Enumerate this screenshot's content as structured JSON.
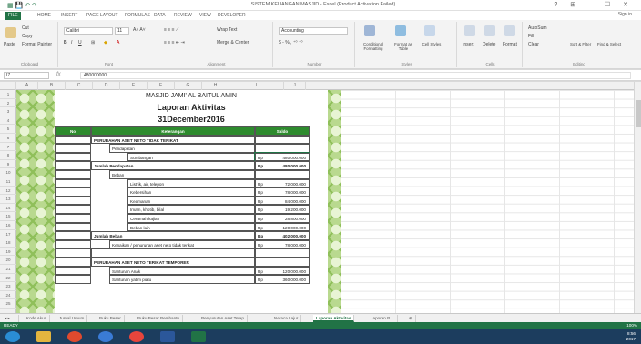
{
  "window": {
    "title": "SISTEM KEUANGAN MASJID - Excel (Product Activation Failed)",
    "controls": "? ⊞ – ☐ ✕"
  },
  "ribbon_tabs": [
    "FILE",
    "HOME",
    "INSERT",
    "PAGE LAYOUT",
    "FORMULAS",
    "DATA",
    "REVIEW",
    "VIEW",
    "DEVELOPER"
  ],
  "sign_in": "Sign in",
  "ribbon": {
    "clipboard": {
      "label": "Clipboard",
      "paste": "Paste",
      "cut": "Cut",
      "copy": "Copy",
      "format_painter": "Format Painter"
    },
    "font": {
      "label": "Font",
      "name": "Calibri",
      "size": "11"
    },
    "alignment": {
      "label": "Alignment",
      "wrap": "Wrap Text",
      "merge": "Merge & Center"
    },
    "number": {
      "label": "Number",
      "format": "Accounting"
    },
    "styles": {
      "label": "Styles",
      "cond": "Conditional Formatting",
      "table": "Format as Table",
      "cell": "Cell Styles"
    },
    "cells": {
      "label": "Cells",
      "insert": "Insert",
      "delete": "Delete",
      "format": "Format"
    },
    "editing": {
      "label": "Editing",
      "autosum": "AutoSum",
      "fill": "Fill",
      "clear": "Clear",
      "sort": "Sort & Filter",
      "find": "Find & Select"
    }
  },
  "formula_bar": {
    "name_box": "I7",
    "fx": "fx",
    "value": "480000000"
  },
  "columns": [
    "A",
    "B",
    "C",
    "D",
    "E",
    "F",
    "G",
    "H",
    "I",
    "J"
  ],
  "rows": [
    "1",
    "2",
    "3",
    "4",
    "5",
    "6",
    "7",
    "8",
    "9",
    "10",
    "11",
    "12",
    "13",
    "14",
    "15",
    "16",
    "17",
    "18",
    "19",
    "20",
    "21",
    "22",
    "23",
    "24",
    "25"
  ],
  "report": {
    "org": "MASJID JAMI' AL BAITUL AMIN",
    "title": "Laporan Aktivitas",
    "date": "31December2016",
    "col_no": "No",
    "col_desc": "Keterangan",
    "col_saldo": "Saldo",
    "lines": [
      {
        "text": "PERUBAHAN ASET NETO TIDAK TERIKAT",
        "indent": 0,
        "amount": ""
      },
      {
        "text": "Pendapatan",
        "indent": 1,
        "amount": ""
      },
      {
        "text": "Sumbangan",
        "indent": 2,
        "amount": "480.000.000"
      },
      {
        "text": "Jumlah Pendapatan",
        "indent": 0,
        "amount": "480.000.000"
      },
      {
        "text": "Beban",
        "indent": 1,
        "amount": ""
      },
      {
        "text": "Listrik, air, telepon",
        "indent": 2,
        "amount": "72.000.000"
      },
      {
        "text": "Kebersihan",
        "indent": 2,
        "amount": "78.000.000"
      },
      {
        "text": "Keamanan",
        "indent": 2,
        "amount": "84.000.000"
      },
      {
        "text": "Imam, khotib, bilal",
        "indent": 2,
        "amount": "19.200.000"
      },
      {
        "text": "Ceramah/kajian",
        "indent": 2,
        "amount": "28.800.000"
      },
      {
        "text": "Beban lain",
        "indent": 2,
        "amount": "120.000.000"
      },
      {
        "text": "Jumlah Beban",
        "indent": 0,
        "amount": "402.000.000"
      },
      {
        "text": "Kenaikan / penurunan aset neto tidak terikat",
        "indent": 1,
        "amount": "78.000.000"
      },
      {
        "text": "",
        "indent": 0,
        "amount": ""
      },
      {
        "text": "PERUBAHAN ASET NETO TERIKAT TEMPORER",
        "indent": 0,
        "amount": ""
      },
      {
        "text": "Santunan Anak",
        "indent": 1,
        "amount": "120.000.000"
      },
      {
        "text": "Santunan yatim piatu",
        "indent": 1,
        "amount": "360.000.000"
      }
    ],
    "currency": "Rp"
  },
  "sheet_tabs": [
    "Kode Akun",
    "Jurnal Umum",
    "Buku Besar",
    "Buku Besar Pembantu",
    "Penyusutan Aset Tetap",
    "Neraca Lajur",
    "Laporan Aktivitas",
    "Laporan P ..."
  ],
  "active_sheet": "Laporan Aktivitas",
  "status": {
    "ready": "READY",
    "zoom": "100%"
  },
  "clock": {
    "time": "8:56",
    "date": "2017"
  }
}
